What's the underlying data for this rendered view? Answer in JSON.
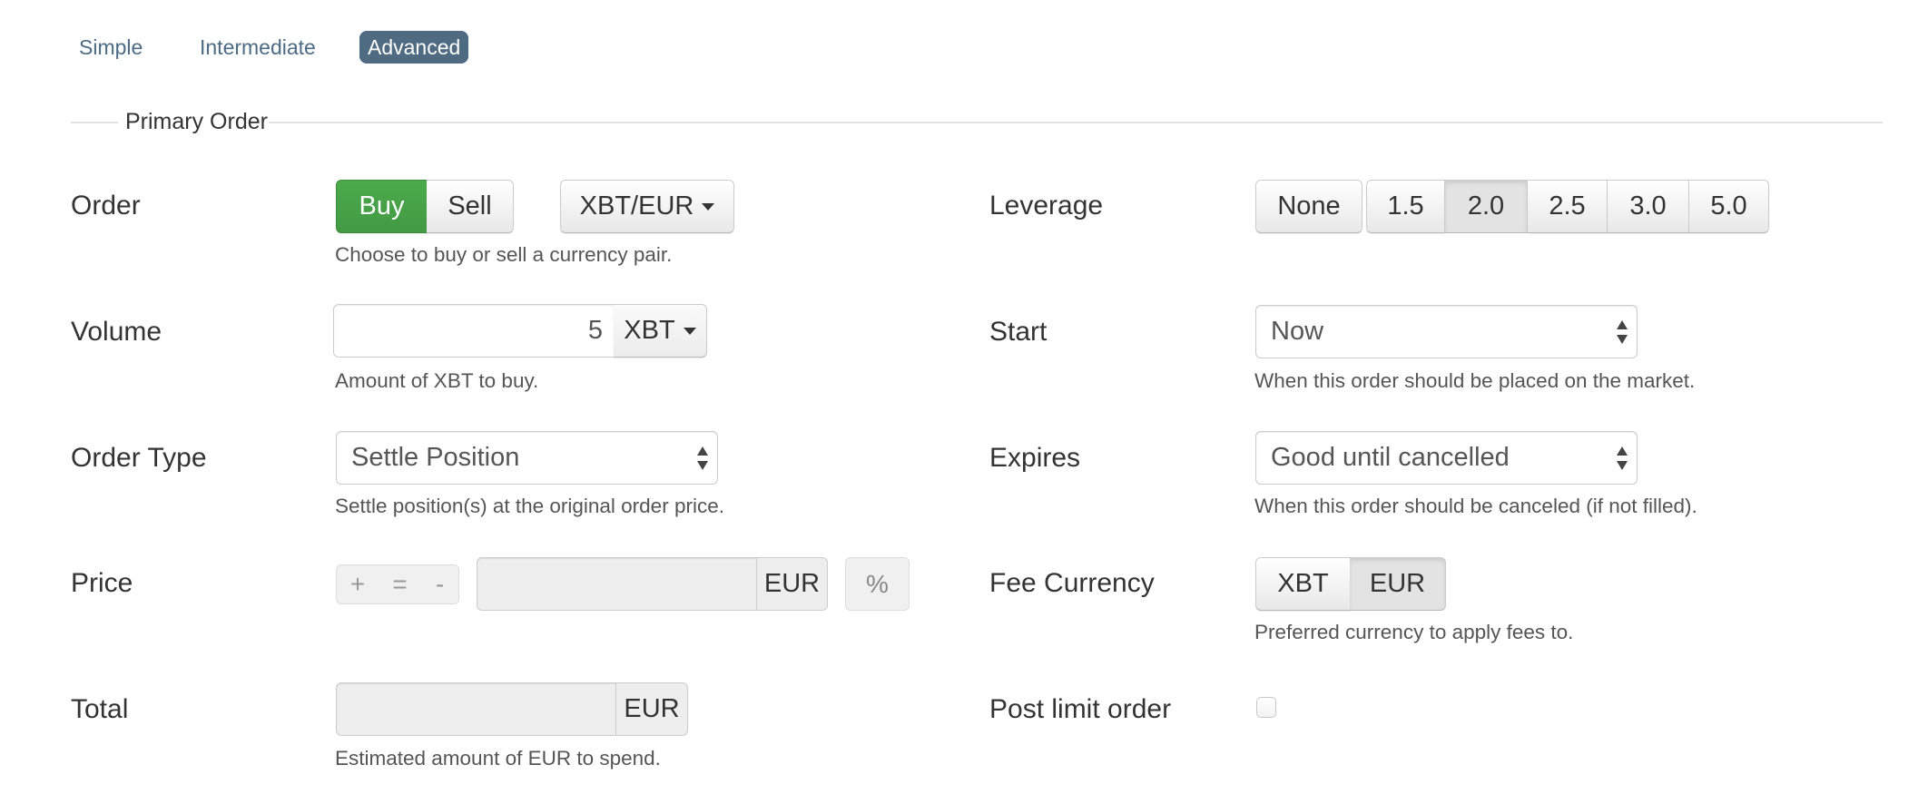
{
  "tabs": [
    {
      "label": "Simple",
      "active": false
    },
    {
      "label": "Intermediate",
      "active": false
    },
    {
      "label": "Advanced",
      "active": true
    }
  ],
  "fieldset": {
    "legend": "Primary Order"
  },
  "colors": {
    "accent": "#4f6b82",
    "buy_green": "#47a447",
    "tab_text": "#4d6b84"
  },
  "left": {
    "order": {
      "label": "Order",
      "buy_label": "Buy",
      "sell_label": "Sell",
      "selected": "Buy",
      "pair_label": "XBT/EUR",
      "help": "Choose to buy or sell a currency pair."
    },
    "volume": {
      "label": "Volume",
      "value": "5",
      "unit_label": "XBT",
      "help": "Amount of XBT to buy."
    },
    "order_type": {
      "label": "Order Type",
      "selected": "Settle Position",
      "help": "Settle position(s) at the original order price."
    },
    "price": {
      "label": "Price",
      "plus_label": "+",
      "equals_label": "=",
      "minus_label": "-",
      "value": "",
      "unit": "EUR",
      "percent_label": "%"
    },
    "total": {
      "label": "Total",
      "value": "",
      "unit": "EUR",
      "help": "Estimated amount of EUR to spend."
    }
  },
  "right": {
    "leverage": {
      "label": "Leverage",
      "none_label": "None",
      "options": [
        "1.5",
        "2.0",
        "2.5",
        "3.0",
        "5.0"
      ],
      "selected": "2.0"
    },
    "start": {
      "label": "Start",
      "selected": "Now",
      "help": "When this order should be placed on the market."
    },
    "expires": {
      "label": "Expires",
      "selected": "Good until cancelled",
      "help": "When this order should be canceled (if not filled)."
    },
    "fee_currency": {
      "label": "Fee Currency",
      "options": [
        "XBT",
        "EUR"
      ],
      "selected": "EUR",
      "help": "Preferred currency to apply fees to."
    },
    "post_limit": {
      "label": "Post limit order",
      "checked": false
    }
  }
}
